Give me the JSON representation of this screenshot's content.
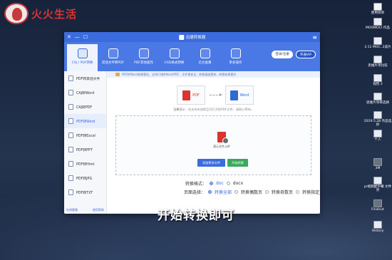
{
  "watermark": {
    "text": "火火生活"
  },
  "desktop": {
    "icons": [
      {
        "label": "使用简单",
        "kind": "app"
      },
      {
        "label": "MOOMOCI\n作品",
        "kind": "doc"
      },
      {
        "label": "3.11\nMOC..2成片",
        "kind": "doc"
      },
      {
        "label": "思维片项比较",
        "kind": "doc"
      },
      {
        "label": "视觉 2",
        "kind": "doc"
      },
      {
        "label": "思维片项目选择",
        "kind": "doc"
      },
      {
        "label": "2019.5.28 作品选好",
        "kind": "doc"
      },
      {
        "label": "个人",
        "kind": "doc"
      },
      {
        "label": "3M",
        "kind": "dark"
      },
      {
        "label": "pr视频配字幕\n文件夹",
        "kind": "doc"
      },
      {
        "label": "Finalcut",
        "kind": "dark"
      },
      {
        "label": "History",
        "kind": "doc"
      }
    ]
  },
  "window": {
    "title": "迅捷转换器",
    "menu_icon": "≡",
    "controls": [
      "✕",
      "—",
      "☐"
    ]
  },
  "toolbar": {
    "tools": [
      {
        "label": "CAJ / PDF转换",
        "icon": "pdf-convert-icon",
        "active": true
      },
      {
        "label": "其他文件转PDF",
        "icon": "to-pdf-icon",
        "active": false
      },
      {
        "label": "PDF其他操作",
        "icon": "pdf-ops-icon",
        "active": false
      },
      {
        "label": "CAD格式转换",
        "icon": "cad-icon",
        "active": false
      },
      {
        "label": "论文查重",
        "icon": "plagiarism-icon",
        "active": false
      },
      {
        "label": "更多操作",
        "icon": "more-icon",
        "active": false
      }
    ],
    "login_label": "登录/注册",
    "vip_label": "开通VIP"
  },
  "sidebar": {
    "items": [
      {
        "label": "PDF转其他文件",
        "active": false
      },
      {
        "label": "CAJ转Word",
        "active": false
      },
      {
        "label": "CAJ转PDF",
        "active": false
      },
      {
        "label": "PDF转Word",
        "active": true
      },
      {
        "label": "PDF转Excel",
        "active": false
      },
      {
        "label": "PDF转PPT",
        "active": false
      },
      {
        "label": "PDF转Html",
        "active": false
      },
      {
        "label": "PDF转JPG",
        "active": false
      },
      {
        "label": "PDF转TXT",
        "active": false
      }
    ],
    "footer_left": "在线客服",
    "footer_right": "使用帮助"
  },
  "main": {
    "notice": "PDF转Word效果更佳，支持CAJ转Word/PDF，文件更安全，转换速度更快，转换效果更好",
    "flow": {
      "from_label": "PDF",
      "to_label": "Word"
    },
    "description": "温馨提示：仅支持未加密且可打开的PDF文件，请耐心等待。",
    "file_name": "演示文件.pdf",
    "add_button": "添加更多文件",
    "start_button": "开始转换",
    "format_label": "转换格式：",
    "format_options": [
      {
        "label": "doc",
        "selected": true
      },
      {
        "label": "docx",
        "selected": false
      }
    ],
    "page_label": "页面选择：",
    "page_options": [
      {
        "label": "转换全部",
        "selected": true
      },
      {
        "label": "转换偶数页",
        "selected": false
      },
      {
        "label": "转换奇数页",
        "selected": false
      },
      {
        "label": "转换指定页面",
        "selected": false
      }
    ]
  },
  "subtitle": "开始转换即可"
}
